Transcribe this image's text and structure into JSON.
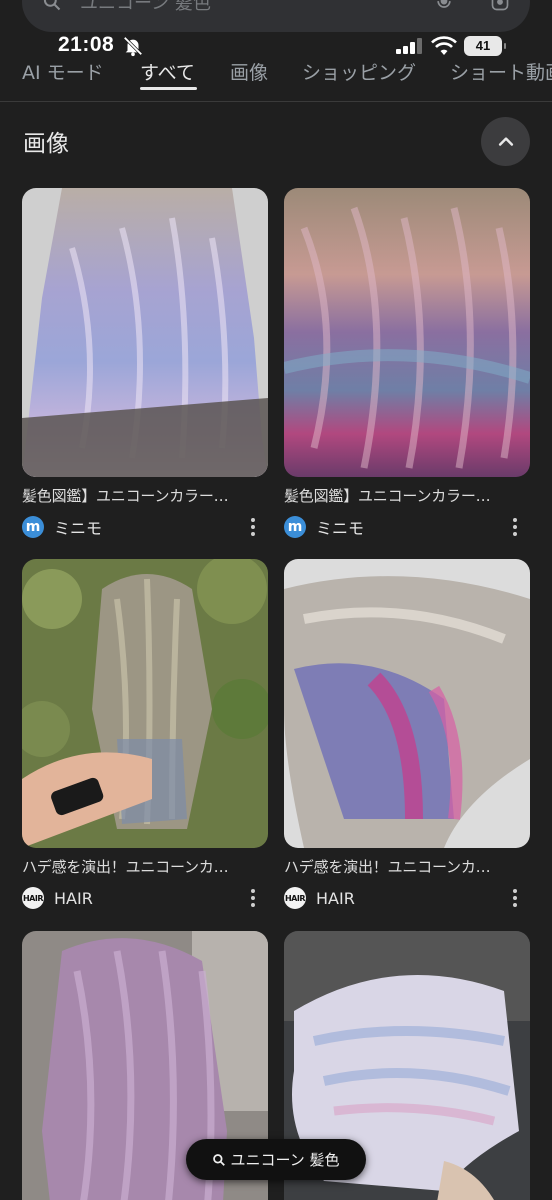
{
  "search": {
    "query": "ユニコーン 髪色"
  },
  "status": {
    "time": "21:08",
    "battery": "41"
  },
  "tabs": [
    {
      "label": "AI モード"
    },
    {
      "label": "すべて"
    },
    {
      "label": "画像"
    },
    {
      "label": "ショッピング"
    },
    {
      "label": "ショート動画"
    }
  ],
  "section": {
    "title": "画像"
  },
  "results": [
    {
      "caption": "髪色図鑑】ユニコーンカラー…",
      "source": "ミニモ",
      "logo_text": "m"
    },
    {
      "caption": "髪色図鑑】ユニコーンカラー…",
      "source": "ミニモ",
      "logo_text": "m"
    },
    {
      "caption": "ハデ感を演出！ユニコーンカ…",
      "source": "HAIR",
      "logo_text": "HAIR"
    },
    {
      "caption": "ハデ感を演出！ユニコーンカ…",
      "source": "HAIR",
      "logo_text": "HAIR"
    },
    {
      "caption": "",
      "source": ""
    },
    {
      "caption": "",
      "source": ""
    }
  ],
  "bottom_pill": {
    "label": "ユニコーン 髪色"
  },
  "icons": {
    "search": "search-icon",
    "mic": "mic-icon",
    "lens": "lens-icon",
    "bell": "bell-off-icon",
    "signal": "signal-icon",
    "wifi": "wifi-icon",
    "chevron": "chevron-up-icon",
    "more": "more-vert-icon"
  },
  "colors": {
    "background": "#1f1f1f",
    "tab_active": "#e8e8e8",
    "tab_inactive": "#9aa0a6",
    "minimo_blue": "#3b8ed8"
  }
}
